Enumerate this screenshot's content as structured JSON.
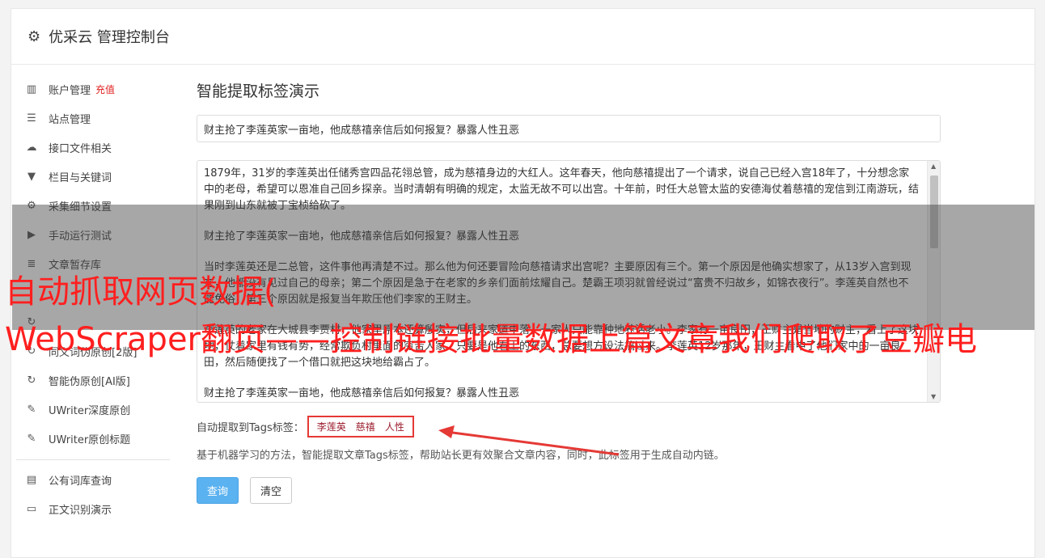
{
  "header": {
    "title": "优采云 管理控制台",
    "icon": "gear-icon"
  },
  "sidebar": {
    "items": [
      {
        "icon": "bar-chart-icon",
        "glyph": "▥",
        "label": "账户管理",
        "badge": "充值"
      },
      {
        "icon": "server-icon",
        "glyph": "☰",
        "label": "站点管理"
      },
      {
        "icon": "cloud-upload-icon",
        "glyph": "☁",
        "label": "接口文件相关"
      },
      {
        "icon": "filter-icon",
        "glyph": "▼",
        "label": "栏目与关键词"
      },
      {
        "icon": "cogs-icon",
        "glyph": "⚙",
        "label": "采集细节设置"
      },
      {
        "icon": "play-circle-icon",
        "glyph": "▶",
        "label": "手动运行测试"
      },
      {
        "icon": "database-icon",
        "glyph": "≣",
        "label": "文章暂存库"
      },
      {
        "icon": "hidden-item-icon",
        "glyph": "·",
        "label": ""
      },
      {
        "icon": "refresh-icon",
        "glyph": "↻",
        "label": ""
      },
      {
        "icon": "refresh-icon",
        "glyph": "↻",
        "label": "同义词伪原创[2版]"
      },
      {
        "icon": "refresh-icon",
        "glyph": "↻",
        "label": "智能伪原创[AI版]"
      },
      {
        "icon": "edit-icon",
        "glyph": "✎",
        "label": "UWriter深度原创"
      },
      {
        "icon": "edit-icon",
        "glyph": "✎",
        "label": "UWriter原创标题"
      }
    ],
    "items2": [
      {
        "icon": "book-icon",
        "glyph": "▤",
        "label": "公有词库查询"
      },
      {
        "icon": "doc-icon",
        "glyph": "▭",
        "label": "正文识别演示"
      }
    ]
  },
  "main": {
    "title": "智能提取标签演示",
    "title_input_value": "财主抢了李莲英家一亩地，他成慈禧亲信后如何报复？暴露人性丑恶",
    "paragraphs": [
      "1879年，31岁的李莲英出任储秀宫四品花翎总管，成为慈禧身边的大红人。这年春天，他向慈禧提出了一个请求，说自己已经入宫18年了，十分想念家中的老母，希望可以恩准自己回乡探亲。当时清朝有明确的规定，太监无故不可以出宫。十年前，时任大总管太监的安德海仗着慈禧的宠信到江南游玩，结果刚到山东就被丁宝桢给砍了。",
      "财主抢了李莲英家一亩地，他成慈禧亲信后如何报复？暴露人性丑恶",
      "当时李莲英还是二总管，这件事他再清楚不过。那么他为何还要冒险向慈禧请求出宫呢？主要原因有三个。第一个原因是他确实想家了，从13岁入宫到现在，他都没有见过自己的母亲；第二个原因是急于在老家的乡亲们面前炫耀自己。楚霸王项羽就曾经说过“富贵不归故乡，如锦衣夜行”。李莲英自然也不能免俗；第三个原因就是报复当年欺压他们李家的王财主。",
      "李莲英的老家在大城县李贾村，他家里原本还算殷实，但后来家道中落，一家人只能靠种地养活老小。李家有一亩良田，王财主是当地的财主，看上了这块地，仗着家里有钱有势，经常欺负村里面的穷苦人家。只要是他看上的东西，总要想方设法搞过来。李莲英12岁那年，王财主看中了他们家中的一亩良田，然后随便找了一个借口就把这块地给霸占了。",
      "财主抢了李莲英家一亩地，他成慈禧亲信后如何报复？暴露人性丑恶"
    ],
    "tags_label": "自动提取到Tags标签：",
    "tags": [
      "李莲英",
      "慈禧",
      "人性"
    ],
    "help_text": "基于机器学习的方法，智能提取文章Tags标签，帮助站长更有效聚合文章内容，同时，此标签用于生成自动内链。",
    "query_button": "查询",
    "clear_button": "清空"
  },
  "overlay": {
    "line1": "自动抓取网页数据(",
    "line2": "WebScraper翻页——控制链接批量数据上篇文章我们爬取了豆瓣电"
  },
  "colors": {
    "accent": "#5bb2f0",
    "highlight": "#e53935",
    "overlay_text": "#ff1f1f"
  }
}
